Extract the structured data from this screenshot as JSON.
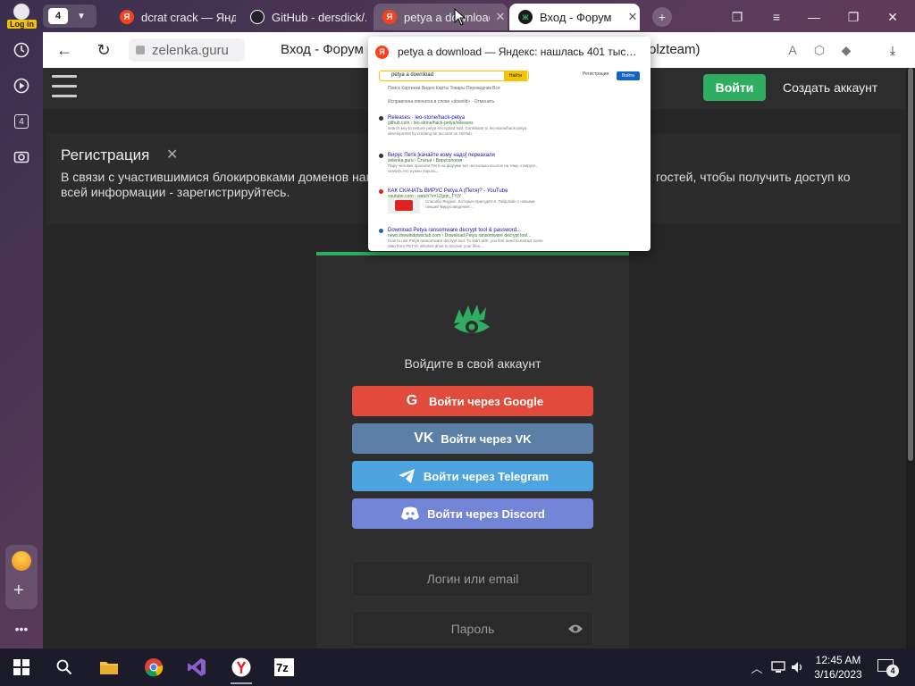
{
  "sidebar": {
    "login_label": "Log in",
    "tab_count": "4"
  },
  "tabs": {
    "count_badge": "4",
    "items": [
      {
        "title": "dcrat crack — Яндекс",
        "favicon": "yandex-icon"
      },
      {
        "title": "GitHub - dersdick/...",
        "favicon": "github-icon"
      },
      {
        "title": "petya a download",
        "favicon": "yandex-icon"
      },
      {
        "title": "Вход - Форум",
        "favicon": "lolzteam-icon"
      }
    ],
    "new_tab_symbol": "+"
  },
  "address_bar": {
    "url": "zelenka.guru",
    "page_title_start": "Вход - Форум",
    "page_title_end": "olzteam)"
  },
  "tab_preview": {
    "title": "petya a download — Яндекс: нашлась 401 тыс…",
    "search": {
      "query": "petya a download",
      "button": "Найти",
      "register": "Регистрация",
      "login": "Войти",
      "tabs": "Поиск  Картинки  Видео  Карты  Товары  Переводчик  Все",
      "correction": "Исправлена опечатка в слове «downld» · Отменить"
    },
    "results": [
      {
        "title": "Releases · leo-stone/hack-petya",
        "url": "github.com › leo-stone/hack-petya/releases",
        "desc": "search key to restore petya encrypted hdd. Contribute to leo-stone/hack-petya development by creating an account on GitHub."
      },
      {
        "title": "Вирус Петя [качайте кому надо] переахали",
        "url": "zelenka.guru › Статьи › Вирусология",
        "desc": "Пару человек просили Петя на форуме вот несколько ссылок на тему о вирусе, скачать его нужен пароль..."
      },
      {
        "title": "КАК СКАЧАТЬ ВИРУС Petya A (Петя)? - YouTube",
        "url": "youtube.com › watch?v=1Zgqn_TYjY",
        "desc": "Спасибо Яндекс. Которые пригодятся. Гайдлайн с новыми лекций 'Вирусоведение'..."
      },
      {
        "title": "Download Petya ransomware decrypt tool & password...",
        "url": "news.thewindowsclub.com › Download Petya ransomware decrypt tool...",
        "desc": "How to use Petya ransomware decrypt tool. To start with, you first need to extract some data from PETYA infected drive to recover your files..."
      }
    ]
  },
  "site": {
    "login_button": "Войти",
    "create_account": "Создать аккаунт",
    "registration": {
      "title": "Регистрация",
      "text_line1": "В связи с участившимися блокировками доменов нам",
      "text_line1_tail": "гостей, чтобы получить доступ ко",
      "text_line2": "всей информации - зарегистрируйтесь."
    },
    "card": {
      "heading": "Войдите в свой аккаунт",
      "google": "Войти через Google",
      "vk": "Войти через VK",
      "telegram": "Войти через Telegram",
      "discord": "Войти через Discord",
      "login_placeholder": "Логин или email",
      "password_placeholder": "Пароль"
    }
  },
  "taskbar": {
    "time": "12:45 AM",
    "date": "3/16/2023",
    "notifications": "4"
  },
  "colors": {
    "brand_green": "#2fae61",
    "google": "#e04b3c",
    "vk": "#5b7fa6",
    "telegram": "#4ea4de",
    "discord": "#7385d6"
  }
}
